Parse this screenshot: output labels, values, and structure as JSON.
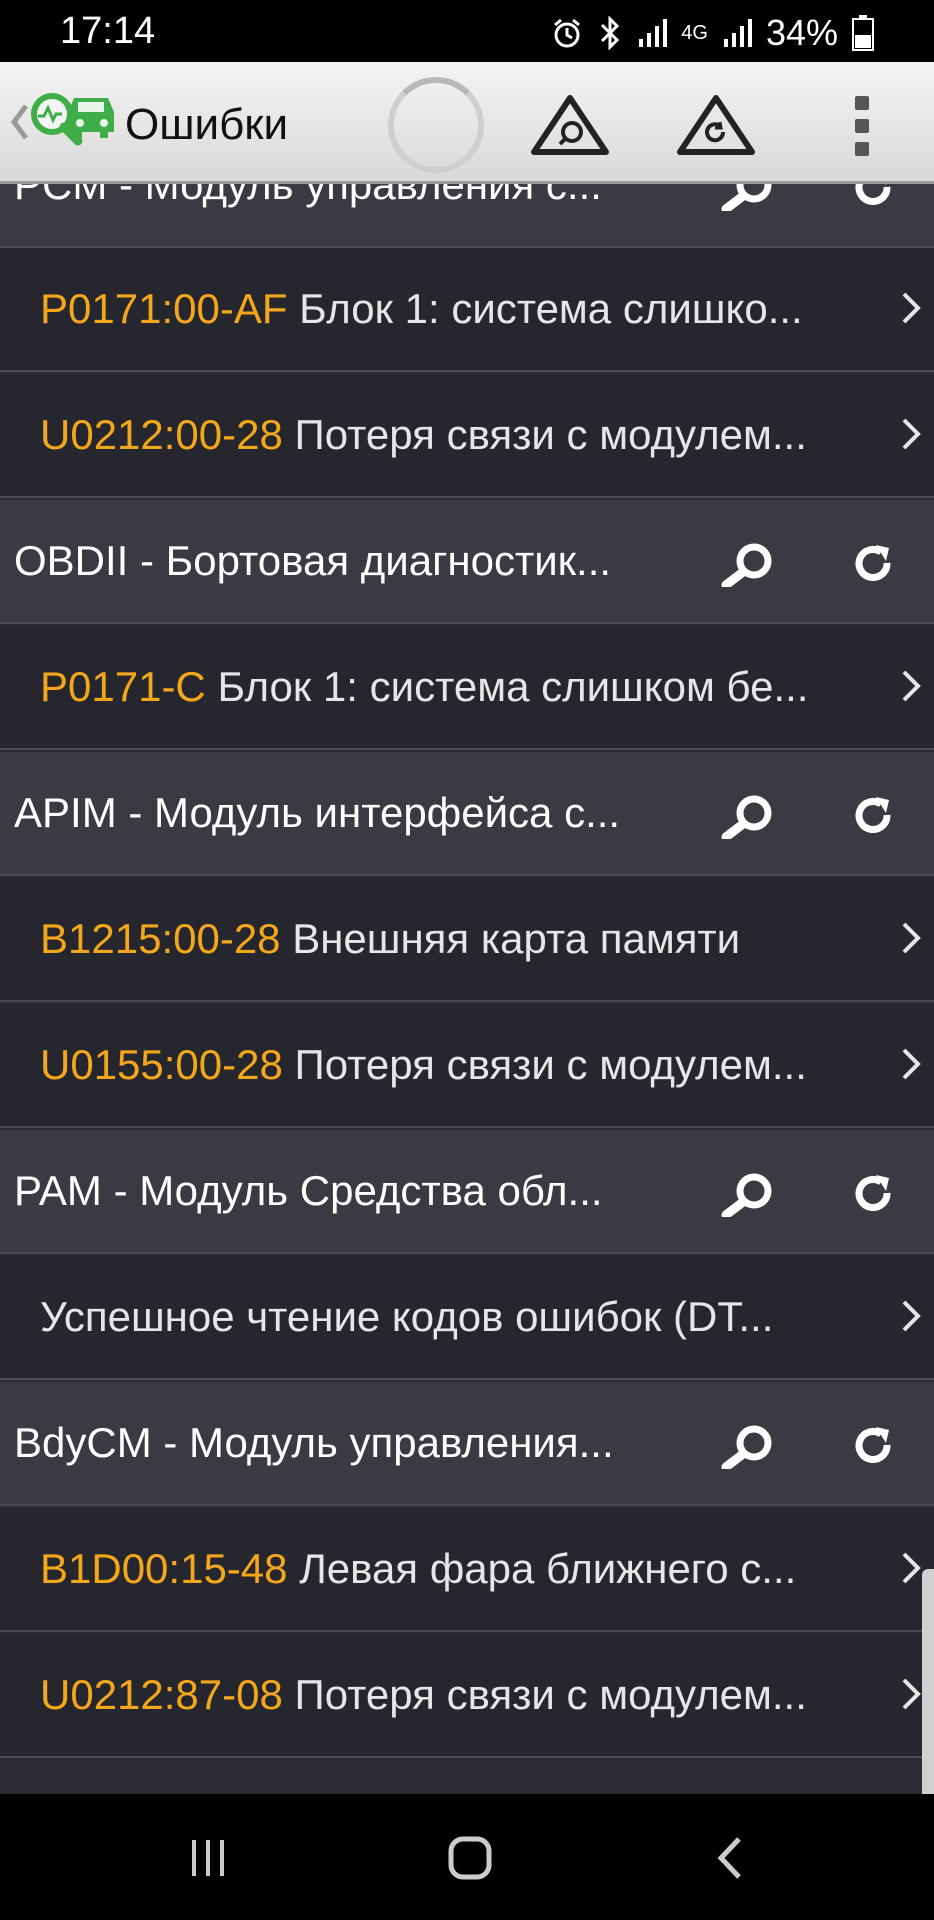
{
  "status_bar": {
    "time": "17:14",
    "network": "4G",
    "battery": "34%"
  },
  "app_bar": {
    "title": "Ошибки"
  },
  "list": [
    {
      "type": "module",
      "name": "PCM - Модуль управления с..."
    },
    {
      "type": "dtc",
      "code": "P0171:00-AF",
      "description": "Блок 1: система слишко..."
    },
    {
      "type": "dtc",
      "code": "U0212:00-28",
      "description": "Потеря связи с модулем..."
    },
    {
      "type": "module",
      "name": "OBDII - Бортовая диагностик..."
    },
    {
      "type": "dtc",
      "code": "P0171-C",
      "description": "Блок 1: система слишком бе..."
    },
    {
      "type": "module",
      "name": "APIM - Модуль интерфейса с..."
    },
    {
      "type": "dtc",
      "code": "B1215:00-28",
      "description": "Внешняя карта памяти"
    },
    {
      "type": "dtc",
      "code": "U0155:00-28",
      "description": "Потеря связи с модулем..."
    },
    {
      "type": "module",
      "name": "PAM - Модуль Средства обл..."
    },
    {
      "type": "dtc",
      "code": "",
      "description": "Успешное чтение кодов ошибок (DT..."
    },
    {
      "type": "module",
      "name": "BdyCM - Модуль управления..."
    },
    {
      "type": "dtc",
      "code": "B1D00:15-48",
      "description": "Левая фара ближнего с..."
    },
    {
      "type": "dtc",
      "code": "U0212:87-08",
      "description": "Потеря связи с модулем..."
    }
  ],
  "colors": {
    "code": "#f5a71b",
    "module_bg": "#393a42",
    "dtc_bg": "#26272e",
    "logo_green": "#3fae49"
  }
}
